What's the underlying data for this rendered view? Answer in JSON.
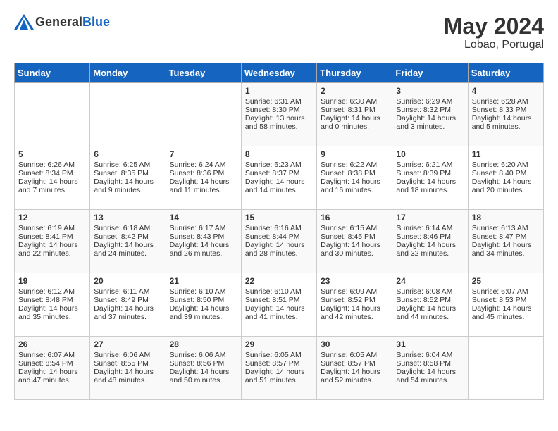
{
  "header": {
    "logo_general": "General",
    "logo_blue": "Blue",
    "month_year": "May 2024",
    "location": "Lobao, Portugal"
  },
  "weekdays": [
    "Sunday",
    "Monday",
    "Tuesday",
    "Wednesday",
    "Thursday",
    "Friday",
    "Saturday"
  ],
  "weeks": [
    [
      {
        "day": "",
        "sunrise": "",
        "sunset": "",
        "daylight": ""
      },
      {
        "day": "",
        "sunrise": "",
        "sunset": "",
        "daylight": ""
      },
      {
        "day": "",
        "sunrise": "",
        "sunset": "",
        "daylight": ""
      },
      {
        "day": "1",
        "sunrise": "Sunrise: 6:31 AM",
        "sunset": "Sunset: 8:30 PM",
        "daylight": "Daylight: 13 hours and 58 minutes."
      },
      {
        "day": "2",
        "sunrise": "Sunrise: 6:30 AM",
        "sunset": "Sunset: 8:31 PM",
        "daylight": "Daylight: 14 hours and 0 minutes."
      },
      {
        "day": "3",
        "sunrise": "Sunrise: 6:29 AM",
        "sunset": "Sunset: 8:32 PM",
        "daylight": "Daylight: 14 hours and 3 minutes."
      },
      {
        "day": "4",
        "sunrise": "Sunrise: 6:28 AM",
        "sunset": "Sunset: 8:33 PM",
        "daylight": "Daylight: 14 hours and 5 minutes."
      }
    ],
    [
      {
        "day": "5",
        "sunrise": "Sunrise: 6:26 AM",
        "sunset": "Sunset: 8:34 PM",
        "daylight": "Daylight: 14 hours and 7 minutes."
      },
      {
        "day": "6",
        "sunrise": "Sunrise: 6:25 AM",
        "sunset": "Sunset: 8:35 PM",
        "daylight": "Daylight: 14 hours and 9 minutes."
      },
      {
        "day": "7",
        "sunrise": "Sunrise: 6:24 AM",
        "sunset": "Sunset: 8:36 PM",
        "daylight": "Daylight: 14 hours and 11 minutes."
      },
      {
        "day": "8",
        "sunrise": "Sunrise: 6:23 AM",
        "sunset": "Sunset: 8:37 PM",
        "daylight": "Daylight: 14 hours and 14 minutes."
      },
      {
        "day": "9",
        "sunrise": "Sunrise: 6:22 AM",
        "sunset": "Sunset: 8:38 PM",
        "daylight": "Daylight: 14 hours and 16 minutes."
      },
      {
        "day": "10",
        "sunrise": "Sunrise: 6:21 AM",
        "sunset": "Sunset: 8:39 PM",
        "daylight": "Daylight: 14 hours and 18 minutes."
      },
      {
        "day": "11",
        "sunrise": "Sunrise: 6:20 AM",
        "sunset": "Sunset: 8:40 PM",
        "daylight": "Daylight: 14 hours and 20 minutes."
      }
    ],
    [
      {
        "day": "12",
        "sunrise": "Sunrise: 6:19 AM",
        "sunset": "Sunset: 8:41 PM",
        "daylight": "Daylight: 14 hours and 22 minutes."
      },
      {
        "day": "13",
        "sunrise": "Sunrise: 6:18 AM",
        "sunset": "Sunset: 8:42 PM",
        "daylight": "Daylight: 14 hours and 24 minutes."
      },
      {
        "day": "14",
        "sunrise": "Sunrise: 6:17 AM",
        "sunset": "Sunset: 8:43 PM",
        "daylight": "Daylight: 14 hours and 26 minutes."
      },
      {
        "day": "15",
        "sunrise": "Sunrise: 6:16 AM",
        "sunset": "Sunset: 8:44 PM",
        "daylight": "Daylight: 14 hours and 28 minutes."
      },
      {
        "day": "16",
        "sunrise": "Sunrise: 6:15 AM",
        "sunset": "Sunset: 8:45 PM",
        "daylight": "Daylight: 14 hours and 30 minutes."
      },
      {
        "day": "17",
        "sunrise": "Sunrise: 6:14 AM",
        "sunset": "Sunset: 8:46 PM",
        "daylight": "Daylight: 14 hours and 32 minutes."
      },
      {
        "day": "18",
        "sunrise": "Sunrise: 6:13 AM",
        "sunset": "Sunset: 8:47 PM",
        "daylight": "Daylight: 14 hours and 34 minutes."
      }
    ],
    [
      {
        "day": "19",
        "sunrise": "Sunrise: 6:12 AM",
        "sunset": "Sunset: 8:48 PM",
        "daylight": "Daylight: 14 hours and 35 minutes."
      },
      {
        "day": "20",
        "sunrise": "Sunrise: 6:11 AM",
        "sunset": "Sunset: 8:49 PM",
        "daylight": "Daylight: 14 hours and 37 minutes."
      },
      {
        "day": "21",
        "sunrise": "Sunrise: 6:10 AM",
        "sunset": "Sunset: 8:50 PM",
        "daylight": "Daylight: 14 hours and 39 minutes."
      },
      {
        "day": "22",
        "sunrise": "Sunrise: 6:10 AM",
        "sunset": "Sunset: 8:51 PM",
        "daylight": "Daylight: 14 hours and 41 minutes."
      },
      {
        "day": "23",
        "sunrise": "Sunrise: 6:09 AM",
        "sunset": "Sunset: 8:52 PM",
        "daylight": "Daylight: 14 hours and 42 minutes."
      },
      {
        "day": "24",
        "sunrise": "Sunrise: 6:08 AM",
        "sunset": "Sunset: 8:52 PM",
        "daylight": "Daylight: 14 hours and 44 minutes."
      },
      {
        "day": "25",
        "sunrise": "Sunrise: 6:07 AM",
        "sunset": "Sunset: 8:53 PM",
        "daylight": "Daylight: 14 hours and 45 minutes."
      }
    ],
    [
      {
        "day": "26",
        "sunrise": "Sunrise: 6:07 AM",
        "sunset": "Sunset: 8:54 PM",
        "daylight": "Daylight: 14 hours and 47 minutes."
      },
      {
        "day": "27",
        "sunrise": "Sunrise: 6:06 AM",
        "sunset": "Sunset: 8:55 PM",
        "daylight": "Daylight: 14 hours and 48 minutes."
      },
      {
        "day": "28",
        "sunrise": "Sunrise: 6:06 AM",
        "sunset": "Sunset: 8:56 PM",
        "daylight": "Daylight: 14 hours and 50 minutes."
      },
      {
        "day": "29",
        "sunrise": "Sunrise: 6:05 AM",
        "sunset": "Sunset: 8:57 PM",
        "daylight": "Daylight: 14 hours and 51 minutes."
      },
      {
        "day": "30",
        "sunrise": "Sunrise: 6:05 AM",
        "sunset": "Sunset: 8:57 PM",
        "daylight": "Daylight: 14 hours and 52 minutes."
      },
      {
        "day": "31",
        "sunrise": "Sunrise: 6:04 AM",
        "sunset": "Sunset: 8:58 PM",
        "daylight": "Daylight: 14 hours and 54 minutes."
      },
      {
        "day": "",
        "sunrise": "",
        "sunset": "",
        "daylight": ""
      }
    ]
  ]
}
